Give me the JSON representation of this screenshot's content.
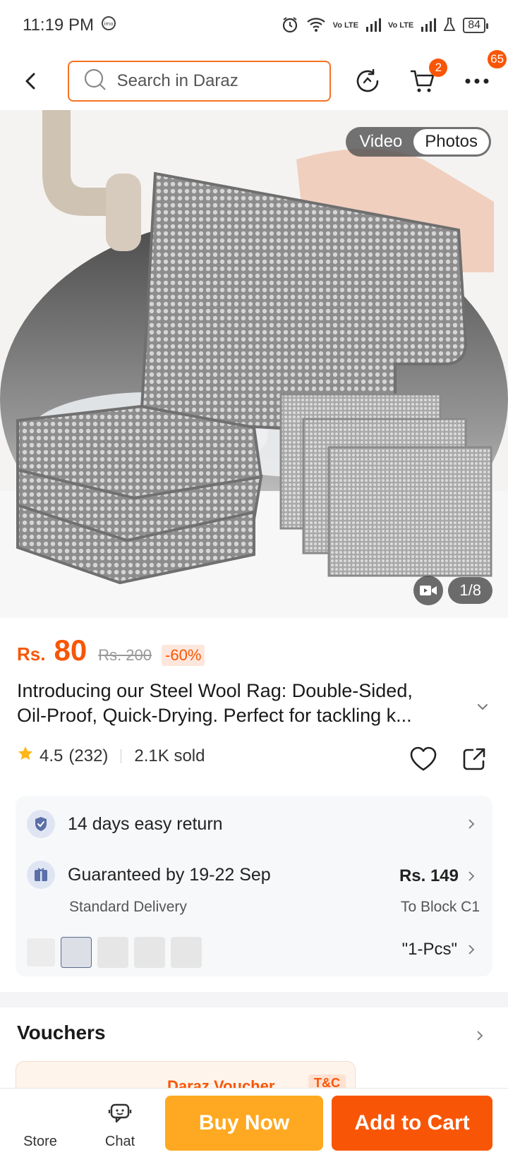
{
  "status_bar": {
    "time": "11:19 PM",
    "battery": "84",
    "icons": [
      "imo-icon",
      "alarm-icon",
      "wifi-icon",
      "volte-icon",
      "signal-icon",
      "volte-icon",
      "signal-icon",
      "lab-icon",
      "battery-icon"
    ],
    "net_labels": [
      "Vo LTE",
      "Vo LTE"
    ]
  },
  "header": {
    "search_placeholder": "Search in Daraz",
    "cart_badge": "2",
    "more_badge": "65",
    "icons": [
      "back-arrow-icon",
      "search-icon",
      "refresh-icon",
      "cart-icon",
      "more-icon"
    ]
  },
  "gallery": {
    "tabs": [
      "Video",
      "Photos"
    ],
    "active_tab": "Photos",
    "counter": "1/8"
  },
  "price": {
    "currency": "Rs.",
    "value": "80",
    "original": "Rs. 200",
    "discount": "-60%"
  },
  "product": {
    "title_line1": "Introducing our Steel Wool Rag: Double-Sided,",
    "title_line2": "Oil-Proof, Quick-Drying. Perfect for tackling k...",
    "rating": "4.5",
    "reviews": "(232)",
    "sold": "2.1K sold"
  },
  "services": {
    "return_text": "14 days easy return",
    "delivery_title": "Guaranteed by 19-22 Sep",
    "delivery_sub": "Standard Delivery",
    "delivery_price": "Rs. 149",
    "delivery_to": "To Block C1",
    "variant_selected": "\"1-Pcs\"",
    "variant_count": 5
  },
  "vouchers": {
    "title": "Vouchers",
    "card_text": "Daraz Voucher",
    "card_tc": "T&C"
  },
  "bottom_bar": {
    "store": "Store",
    "chat": "Chat",
    "buy_now": "Buy Now",
    "add_to_cart": "Add to Cart"
  },
  "colors": {
    "accent": "#f85606",
    "buy_now": "#fea921",
    "search_border": "#f57224"
  }
}
